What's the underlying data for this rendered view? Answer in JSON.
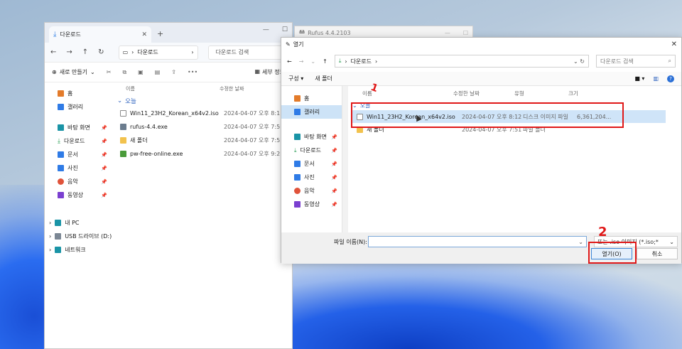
{
  "explorer": {
    "tab_title": "다운로드",
    "tab_close": "✕",
    "tab_add": "+",
    "address": "다운로드",
    "search_placeholder": "다운로드 검색",
    "new_label": "새로 만들기",
    "view_label": "세부 정보",
    "column_name": "이름",
    "column_date": "수정한 날짜",
    "group_label": "오늘",
    "sidebar": [
      {
        "label": "홈",
        "icon": "home-icon"
      },
      {
        "label": "갤러리",
        "icon": "gallery-icon"
      },
      {
        "label": "바탕 화면",
        "icon": "desktop-icon",
        "pinned": true
      },
      {
        "label": "다운로드",
        "icon": "download-icon",
        "pinned": true
      },
      {
        "label": "문서",
        "icon": "document-icon",
        "pinned": true
      },
      {
        "label": "사진",
        "icon": "picture-icon",
        "pinned": true
      },
      {
        "label": "음악",
        "icon": "music-icon",
        "pinned": true
      },
      {
        "label": "동영상",
        "icon": "video-icon",
        "pinned": true
      }
    ],
    "tree": [
      {
        "label": "내 PC",
        "icon": "pc-icon"
      },
      {
        "label": "USB 드라이브 (D:)",
        "icon": "usb-drive-icon"
      },
      {
        "label": "네트워크",
        "icon": "network-icon"
      }
    ],
    "files": [
      {
        "name": "Win11_23H2_Korean_x64v2.iso",
        "date": "2024-04-07 오후 8:1",
        "icon": "file"
      },
      {
        "name": "rufus-4.4.exe",
        "date": "2024-04-07 오후 7:5",
        "icon": "exe"
      },
      {
        "name": "새 폴더",
        "date": "2024-04-07 오후 7:5",
        "icon": "folder"
      },
      {
        "name": "pw-free-online.exe",
        "date": "2024-04-07 오후 9:2",
        "icon": "green"
      }
    ]
  },
  "rufus_title": "Rufus 4.4.2103",
  "dialog": {
    "title": "열기",
    "close": "✕",
    "address": "다운로드",
    "search_placeholder": "다운로드 검색",
    "organize_label": "구성 ▾",
    "new_folder_label": "새 폴더",
    "columns": {
      "name": "이름",
      "date": "수정한 날짜",
      "type": "유형",
      "size": "크기"
    },
    "group_label": "오늘",
    "sidebar": [
      {
        "label": "홈",
        "icon": "home-icon"
      },
      {
        "label": "갤러리",
        "icon": "gallery-icon",
        "selected": true
      },
      {
        "label": "바탕 화면",
        "icon": "desktop-icon",
        "pinned": true
      },
      {
        "label": "다운로드",
        "icon": "download-icon",
        "pinned": true
      },
      {
        "label": "문서",
        "icon": "document-icon",
        "pinned": true
      },
      {
        "label": "사진",
        "icon": "picture-icon",
        "pinned": true
      },
      {
        "label": "음악",
        "icon": "music-icon",
        "pinned": true
      },
      {
        "label": "동영상",
        "icon": "video-icon",
        "pinned": true
      }
    ],
    "files": [
      {
        "name": "Win11_23H2_Korean_x64v2.iso",
        "date": "2024-04-07 오후 8:12",
        "type": "디스크 이미지 파일",
        "size": "6,361,204..."
      },
      {
        "name": "새 폴더",
        "date": "2024-04-07 오후 7:51",
        "type": "파일 폴더",
        "size": ""
      }
    ],
    "filename_label": "파일 이름(N):",
    "filetype_value": "또는 .iso 이미지 (*.iso;*",
    "open_label": "열기(O)",
    "cancel_label": "취소"
  },
  "annotations": {
    "one": "1",
    "two": "2"
  }
}
